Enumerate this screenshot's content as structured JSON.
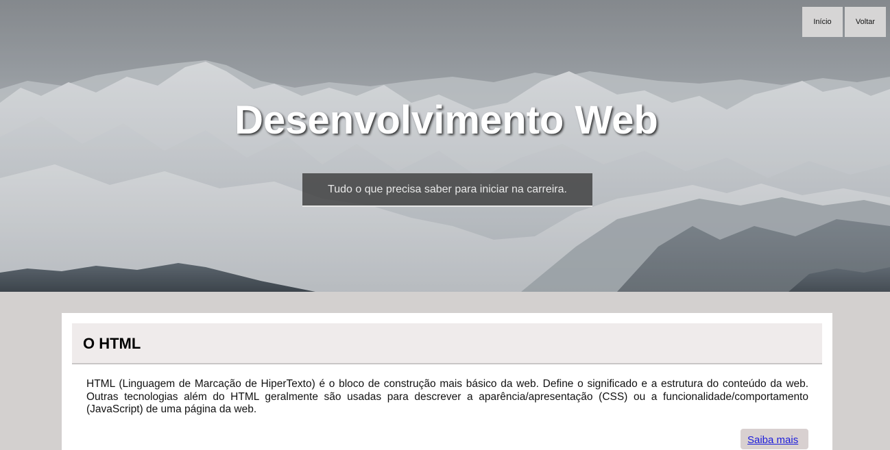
{
  "nav": {
    "home_label": "Início",
    "back_label": "Voltar"
  },
  "hero": {
    "title": "Desenvolvimento Web",
    "subtitle": "Tudo o que precisa saber para iniciar na carreira.",
    "background_image": "snowy-mountains"
  },
  "section": {
    "title": "O HTML",
    "text": "HTML (Linguagem de Marcação de HiperTexto) é o bloco de construção mais básico da web. Define o significado e a estrutura do conteúdo da web. Outras tecnologias além do HTML geralmente são usadas para descrever a aparência/apresentação (CSS) ou a funcionalidade/comportamento (JavaScript) de uma página da web.",
    "more_label": "Saiba mais"
  },
  "colors": {
    "page_background": "#d3d0cf",
    "card_background": "#ffffff",
    "card_header_background": "#efebeb",
    "nav_button_background": "#d6d5d5",
    "subtitle_background": "#373737",
    "link_color": "#1a1adb"
  }
}
